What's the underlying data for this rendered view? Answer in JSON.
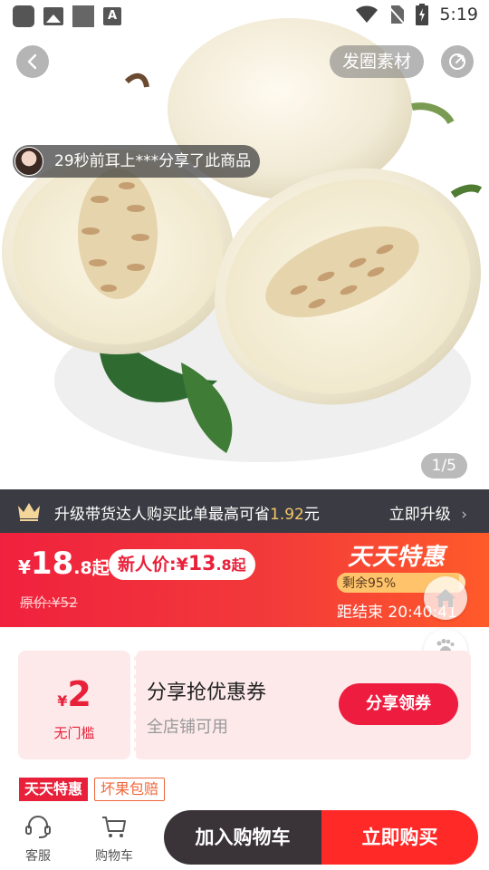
{
  "status_bar": {
    "time": "5:19",
    "icons": [
      "notification-square-icon",
      "image-icon",
      "square-icon",
      "text-a-icon",
      "wifi-icon",
      "no-sim-icon",
      "battery-charging-icon"
    ]
  },
  "hero": {
    "faquan_label": "发圈素材",
    "share_text": "29秒前耳上***分享了此商品",
    "page_indicator": "1/5",
    "product_image": "white-melon-photo"
  },
  "upgrade_bar": {
    "text": "升级带货达人购买此单最高可省",
    "amount": "1.92",
    "unit": "元",
    "link": "立即升级"
  },
  "price": {
    "yen": "¥",
    "integer": "18",
    "decimal": ".8起",
    "new_user_label": "新人价:",
    "new_user_yen": "¥",
    "new_user_integer": "13",
    "new_user_decimal": ".8起",
    "original": "原价:¥52",
    "promo_title": "天天特惠",
    "remaining_text": "剩余95%",
    "remaining_fraction": 0.95,
    "countdown": "距结束 20:40:41"
  },
  "coupon": {
    "yen": "¥",
    "amount": "2",
    "condition": "无门槛",
    "title": "分享抢优惠券",
    "subtitle": "全店铺可用",
    "button": "分享领券"
  },
  "tags": [
    "天天特惠",
    "坏果包赔"
  ],
  "bottom_bar": {
    "service_label": "客服",
    "cart_label": "购物车",
    "add_to_cart": "加入购物车",
    "buy_now": "立即购买"
  },
  "colors": {
    "brand_red": "#ee1c3f",
    "buy_red": "#ff2a28",
    "cart_dark": "#3a3338",
    "gold": "#f3c86a"
  }
}
